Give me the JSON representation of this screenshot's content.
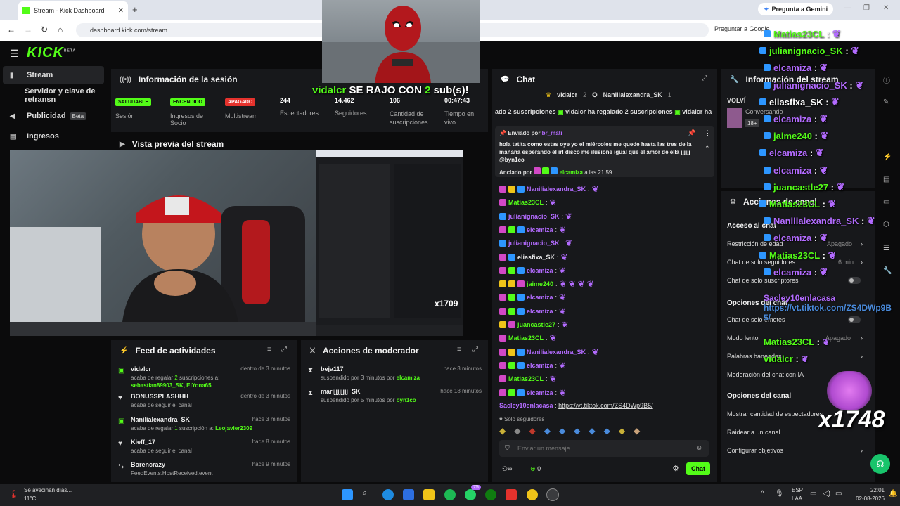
{
  "browser": {
    "tab_title": "Stream - Kick Dashboard",
    "url": "dashboard.kick.com/stream",
    "gemini_label": "Pregunta a Gemini",
    "ask_google": "Preguntar a Google"
  },
  "app": {
    "logo": "KICK",
    "logo_sup": "BETA"
  },
  "sidebar": {
    "items": [
      {
        "label": "Stream",
        "beta": ""
      },
      {
        "label": "Servidor y clave de retransn",
        "beta": ""
      },
      {
        "label": "Publicidad",
        "beta": "Beta"
      },
      {
        "label": "Ingresos",
        "beta": ""
      }
    ]
  },
  "session": {
    "title": "Información de la sesión",
    "badges": [
      {
        "text": "SALUDABLE",
        "label": "Sesión",
        "color": "#53fc18"
      },
      {
        "text": "ENCENDIDO",
        "label": "Ingresos de Socio",
        "color": "#53fc18"
      },
      {
        "text": "APAGADO",
        "label": "Multistream",
        "color": "#e5322d"
      }
    ],
    "stats": [
      {
        "value": "244",
        "label": "Espectadores"
      },
      {
        "value": "14.462",
        "label": "Seguidores"
      },
      {
        "value": "106",
        "label": "Cantidad de suscripciones"
      },
      {
        "value": "00:47:43",
        "label": "Tiempo en vivo"
      }
    ]
  },
  "preview": {
    "title": "Vista previa del stream",
    "screen_counter": "x1709"
  },
  "deadpool": {
    "name": "vidalcr",
    "text": "SE RAJO CON",
    "count": "2",
    "suffix": "sub(s)!"
  },
  "activity": {
    "title": "Feed de actividades",
    "rows": [
      {
        "name": "vidalcr",
        "time": "dentro de 3 minutos",
        "sub": "acaba de regalar",
        "num": "2",
        "sub2": "suscripciones a:",
        "extra": "sebastian89903_SK, ElYona65"
      },
      {
        "name": "BONUSSPLASHHH",
        "time": "dentro de 3 minutos",
        "sub": "acaba de seguir el canal",
        "num": "",
        "sub2": "",
        "extra": ""
      },
      {
        "name": "Nanilialexandra_SK",
        "time": "hace 3 minutos",
        "sub": "acaba de regalar",
        "num": "1",
        "sub2": "suscripción a:",
        "extra": "Leojavier2309"
      },
      {
        "name": "Kieff_17",
        "time": "hace 8 minutos",
        "sub": "acaba de seguir el canal",
        "num": "",
        "sub2": "",
        "extra": ""
      },
      {
        "name": "Borencrazy",
        "time": "hace 9 minutos",
        "sub": "FeedEvents.HostReceived.event",
        "num": "",
        "sub2": "",
        "extra": ""
      }
    ]
  },
  "moderator": {
    "title": "Acciones de moderador",
    "rows": [
      {
        "name": "beja117",
        "time": "hace 3 minutos",
        "sub": "suspendido por 3 minutos por",
        "by": "elcamiza"
      },
      {
        "name": "marijjjjjjjj_SK",
        "time": "hace 18 minutos",
        "sub": "suspendido por 5 minutos por",
        "by": "byn1co"
      }
    ]
  },
  "chat": {
    "title": "Chat",
    "top_gifters": [
      {
        "name": "vidalcr",
        "count": "2"
      },
      {
        "name": "Nanilialexandra_SK",
        "count": "1"
      }
    ],
    "ticker": [
      "ado 2 suscripciones",
      "vidalcr ha regalado 2 suscripciones",
      "vidalcr ha re"
    ],
    "pinned": {
      "sent_by_label": "Enviado por",
      "sent_by": "br_mati",
      "text": "hola tatita como estas oye yo el miércoles me quede hasta las tres de la mañana esperando el irl disco me ilusione igual que el amor de ella jjjjjj @byn1co",
      "pinned_by_label": "Anclado por",
      "pinned_by": "elcamiza",
      "pinned_time": "a las 21:59"
    },
    "messages": [
      {
        "user": "Nanilialexandra_SK",
        "color": "#b36bff",
        "badges": [
          "bp",
          "by",
          "bb"
        ],
        "text": "",
        "emotes": 1
      },
      {
        "user": "Matias23CL",
        "color": "#53fc18",
        "badges": [
          "bp"
        ],
        "text": "",
        "emotes": 1
      },
      {
        "user": "julianignacio_SK",
        "color": "#b36bff",
        "badges": [
          "bb"
        ],
        "text": "",
        "emotes": 1
      },
      {
        "user": "elcamiza",
        "color": "#b36bff",
        "badges": [
          "bp",
          "bg",
          "bb"
        ],
        "text": "",
        "emotes": 1
      },
      {
        "user": "julianignacio_SK",
        "color": "#b36bff",
        "badges": [
          "bb"
        ],
        "text": "",
        "emotes": 1
      },
      {
        "user": "eliasfixa_SK",
        "color": "#e9e9ea",
        "badges": [
          "bp",
          "bb"
        ],
        "text": "",
        "emotes": 1
      },
      {
        "user": "elcamiza",
        "color": "#b36bff",
        "badges": [
          "bp",
          "bg",
          "bb"
        ],
        "text": "",
        "emotes": 1
      },
      {
        "user": "jaime240",
        "color": "#53fc18",
        "badges": [
          "by",
          "by",
          "bp"
        ],
        "text": "",
        "emotes": 4
      },
      {
        "user": "elcamiza",
        "color": "#b36bff",
        "badges": [
          "bp",
          "bg",
          "bb"
        ],
        "text": "",
        "emotes": 1
      },
      {
        "user": "elcamiza",
        "color": "#b36bff",
        "badges": [
          "bp",
          "bg",
          "bb"
        ],
        "text": "",
        "emotes": 1
      },
      {
        "user": "juancastle27",
        "color": "#53fc18",
        "badges": [
          "by",
          "bp"
        ],
        "text": "",
        "emotes": 1
      },
      {
        "user": "Matias23CL",
        "color": "#53fc18",
        "badges": [
          "bp"
        ],
        "text": "",
        "emotes": 1
      },
      {
        "user": "Nanilialexandra_SK",
        "color": "#b36bff",
        "badges": [
          "bp",
          "by",
          "bb"
        ],
        "text": "",
        "emotes": 1
      },
      {
        "user": "elcamiza",
        "color": "#b36bff",
        "badges": [
          "bp",
          "bg",
          "bb"
        ],
        "text": "",
        "emotes": 1
      },
      {
        "user": "Matias23CL",
        "color": "#53fc18",
        "badges": [
          "bp"
        ],
        "text": "",
        "emotes": 1
      },
      {
        "user": "elcamiza",
        "color": "#b36bff",
        "badges": [
          "bp",
          "bg",
          "bb"
        ],
        "text": "",
        "emotes": 1
      }
    ],
    "last_message": {
      "user": "Sacley10enlacasa",
      "text": "https://vt.tiktok.com/ZS4DWp9B5/"
    },
    "followers_only": "Solo seguidores",
    "input_placeholder": "Enviar un mensaje",
    "count": "0",
    "send_label": "Chat"
  },
  "stream_info": {
    "title": "Información del stream",
    "stream_title": "VOLVÍ",
    "category": "Conversando",
    "age": "18+"
  },
  "channel_actions": {
    "title": "Acciones de canal",
    "access_title": "Acceso al chat",
    "access": [
      {
        "label": "Restricción de edad",
        "value": "Apagado"
      },
      {
        "label": "Chat de solo seguidores",
        "value": "6 min"
      },
      {
        "label": "Chat de solo suscriptores",
        "value": ""
      }
    ],
    "options_title": "Opciones del chat",
    "options": [
      {
        "label": "Chat de solo emotes",
        "value": ""
      },
      {
        "label": "Modo lento",
        "value": "Apagado"
      },
      {
        "label": "Palabras baneadas",
        "value": ""
      },
      {
        "label": "Moderación del chat con IA",
        "value": ""
      }
    ],
    "channel_title": "Opciones del canal",
    "channel": [
      {
        "label": "Mostrar cantidad de espectadores"
      },
      {
        "label": "Raidear a un canal"
      },
      {
        "label": "Configurar objetivos"
      }
    ]
  },
  "overlay": {
    "lines": [
      {
        "user": "Matias23CL",
        "color": "#53fc18"
      },
      {
        "user": "julianignacio_SK",
        "color": "#53fc18"
      },
      {
        "user": "elcamiza",
        "color": "#b36bff"
      },
      {
        "user": "julianignacio_SK",
        "color": "#b36bff"
      },
      {
        "user": "eliasfixa_SK",
        "color": "#ffffff"
      },
      {
        "user": "elcamiza",
        "color": "#b36bff"
      },
      {
        "user": "jaime240",
        "color": "#53fc18"
      },
      {
        "user": "elcamiza",
        "color": "#b36bff"
      },
      {
        "user": "elcamiza",
        "color": "#b36bff"
      },
      {
        "user": "juancastle27",
        "color": "#53fc18"
      },
      {
        "user": "Matias23CL",
        "color": "#53fc18"
      },
      {
        "user": "Nanilialexandra_SK",
        "color": "#b36bff"
      },
      {
        "user": "elcamiza",
        "color": "#b36bff"
      },
      {
        "user": "Matias23CL",
        "color": "#53fc18"
      },
      {
        "user": "elcamiza",
        "color": "#b36bff"
      }
    ],
    "sacley_user": "Sacley10enlacasa",
    "sacley_link": "https://vt.tiktok.com/ZS4DWp9B",
    "sacley_link2": "5/",
    "matias_last": "Matias23CL",
    "vidal_last": "vidalcr",
    "counter": "x1748"
  },
  "taskbar": {
    "weather_title": "Se avecinan días...",
    "weather_temp": "11°C",
    "lang": "ESP",
    "lang2": "LAA",
    "time": "22:01",
    "date": "02-08-2026",
    "whatsapp_badge": "75"
  }
}
